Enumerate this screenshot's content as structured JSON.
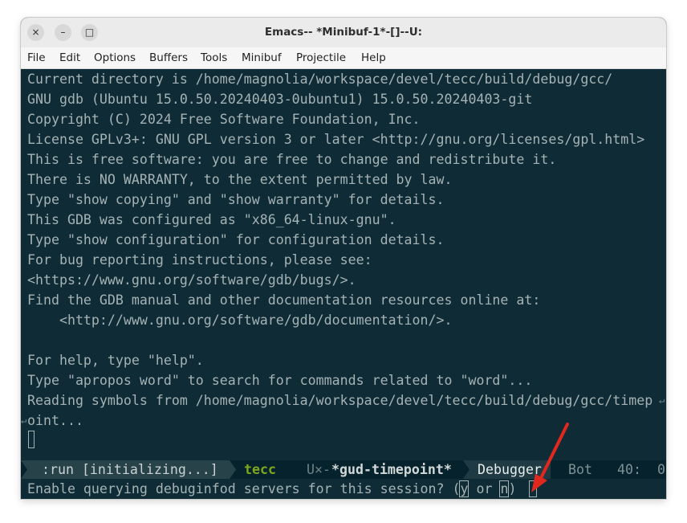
{
  "window": {
    "title": "Emacs-- *Minibuf-1*-[]--U:",
    "controls": {
      "close": "×",
      "minimize": "–",
      "maximize": "□"
    }
  },
  "menu": [
    "File",
    "Edit",
    "Options",
    "Buffers",
    "Tools",
    "Minibuf",
    "Projectile",
    "Help"
  ],
  "buffer": {
    "lines": [
      "Current directory is /home/magnolia/workspace/devel/tecc/build/debug/gcc/",
      "GNU gdb (Ubuntu 15.0.50.20240403-0ubuntu1) 15.0.50.20240403-git",
      "Copyright (C) 2024 Free Software Foundation, Inc.",
      "License GPLv3+: GNU GPL version 3 or later <http://gnu.org/licenses/gpl.html>",
      "This is free software: you are free to change and redistribute it.",
      "There is NO WARRANTY, to the extent permitted by law.",
      "Type \"show copying\" and \"show warranty\" for details.",
      "This GDB was configured as \"x86_64-linux-gnu\".",
      "Type \"show configuration\" for configuration details.",
      "For bug reporting instructions, please see:",
      "<https://www.gnu.org/software/gdb/bugs/>.",
      "Find the GDB manual and other documentation resources online at:",
      "    <http://www.gnu.org/software/gdb/documentation/>.",
      "",
      "For help, type \"help\".",
      "Type \"apropos word\" to search for commands related to \"word\"...",
      "Reading symbols from /home/magnolia/workspace/devel/tecc/build/debug/gcc/timep",
      "oint..."
    ],
    "wrap_glyph": "↵"
  },
  "modeline": {
    "status": " :run [initializing...] ",
    "project": " tecc ",
    "coding": "U×-",
    "buffer_name": "*gud-timepoint*",
    "mode": "Debugger",
    "position": "Bot",
    "line": "40:",
    "column": "0"
  },
  "minibuffer": {
    "prompt": "Enable querying debuginfod servers for this session? (",
    "yes": "y",
    "or": " or ",
    "no": "n",
    "close": ")"
  },
  "colors": {
    "background": "#0e2b36",
    "foreground": "#a6b3b4",
    "project": "#7fa61e",
    "buffer_name": "#d2d8d8",
    "annotation_arrow": "#e0281e"
  }
}
